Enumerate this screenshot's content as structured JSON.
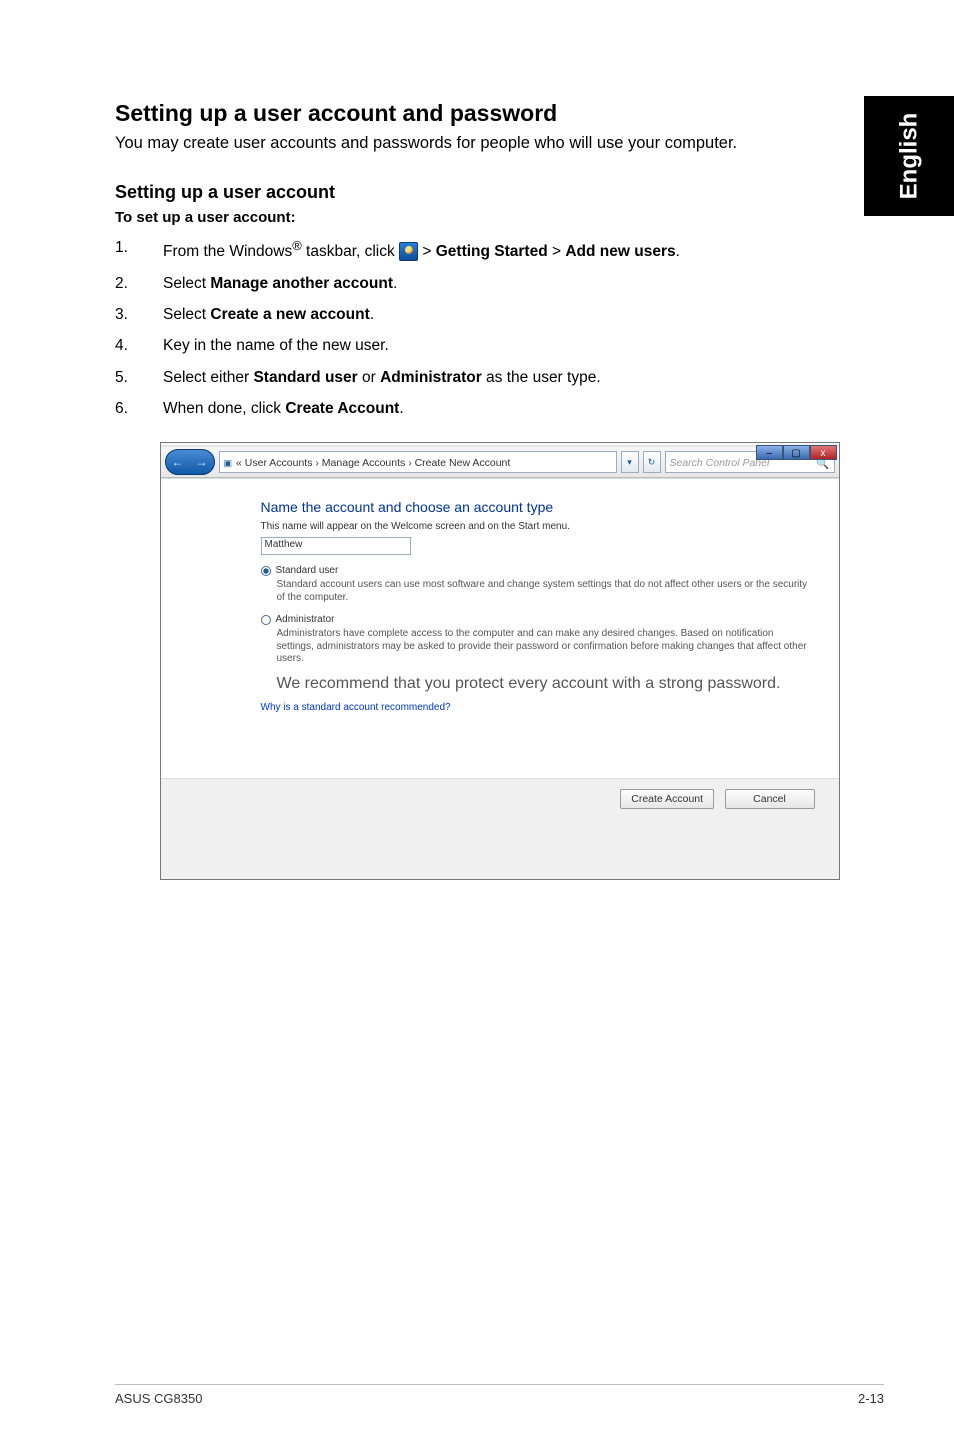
{
  "sideTab": "English",
  "heading": "Setting up a user account and password",
  "intro": "You may create user accounts and passwords for people who will use your computer.",
  "subheading": "Setting up a user account",
  "subheading_bold": "To set up a user account:",
  "steps": {
    "s1a": "From the Windows",
    "s1b": " taskbar, click ",
    "s1c": " > ",
    "s1_getting": "Getting Started",
    "s1d": " > ",
    "s1_add": "Add new users",
    "s1e": ".",
    "s2a": "Select ",
    "s2_b": "Manage another account",
    "s2c": ".",
    "s3a": "Select ",
    "s3_b": "Create a new account",
    "s3c": ".",
    "s4": "Key in the name of the new user.",
    "s5a": "Select either ",
    "s5_b1": "Standard user",
    "s5b": " or ",
    "s5_b2": "Administrator",
    "s5c": " as the user type.",
    "s6a": "When done, click ",
    "s6_b": "Create Account",
    "s6c": "."
  },
  "screenshot": {
    "breadcrumb": "« User Accounts  ›  Manage Accounts  ›  Create New Account",
    "search_placeholder": "Search Control Panel",
    "title": "Name the account and choose an account type",
    "sub": "This name will appear on the Welcome screen and on the Start menu.",
    "input_value": "Matthew",
    "std_label": "Standard user",
    "std_desc": "Standard account users can use most software and change system settings that do not affect other users or the security of the computer.",
    "adm_label": "Administrator",
    "adm_desc": "Administrators have complete access to the computer and can make any desired changes. Based on notification settings, administrators may be asked to provide their password or confirmation before making changes that affect other users.",
    "recommend": "We recommend that you protect every account with a strong password.",
    "why_link": "Why is a standard account recommended?",
    "btn_create": "Create Account",
    "btn_cancel": "Cancel"
  },
  "footer": {
    "left": "ASUS CG8350",
    "right": "2-13"
  }
}
